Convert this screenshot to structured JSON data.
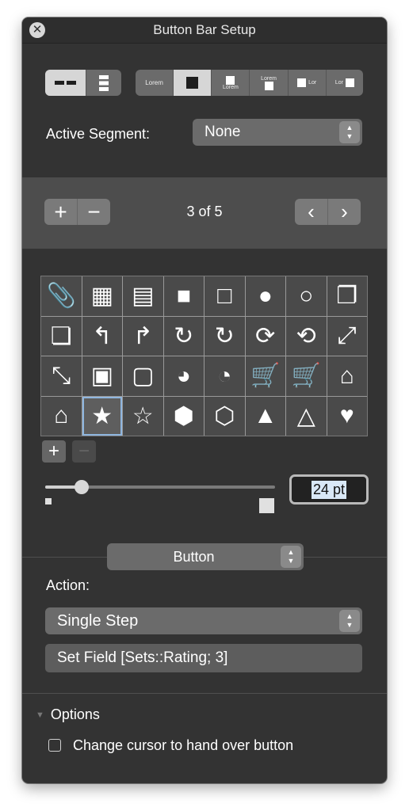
{
  "window": {
    "title": "Button Bar Setup"
  },
  "orientation": {
    "options": [
      {
        "name": "horizontal",
        "icon": "horizontal-layout-icon",
        "selected": true
      },
      {
        "name": "vertical",
        "icon": "vertical-layout-icon",
        "selected": false
      }
    ]
  },
  "style_segments": {
    "lorem_label": "Lorem",
    "lor_label": "Lor",
    "selected_index": 1
  },
  "active_segment": {
    "label": "Active Segment:",
    "value": "None"
  },
  "pager": {
    "text": "3 of 5",
    "add_symbol": "+",
    "remove_symbol": "−",
    "prev_symbol": "‹",
    "next_symbol": "›"
  },
  "icon_grid": {
    "icons": [
      "paperclip-icon",
      "table-filled-icon",
      "table-outline-icon",
      "box-filled-icon",
      "box-outline-icon",
      "speech-bubble-filled-icon",
      "speech-bubble-outline-icon",
      "copy-filled-icon",
      "copy-outline-icon",
      "back-arrow-filled-icon",
      "back-arrow-outline-icon",
      "refresh-filled-icon",
      "refresh-outline-icon",
      "sync-filled-icon",
      "sync-outline-icon",
      "expand-filled-icon",
      "expand-outline-icon",
      "id-card-filled-icon",
      "id-card-outline-icon",
      "pie-chart-filled-icon",
      "pie-chart-outline-icon",
      "cart-filled-icon",
      "cart-outline-icon",
      "home-filled-icon",
      "home-outline-icon",
      "star-filled-icon",
      "star-outline-icon",
      "octagon-alert-filled-icon",
      "octagon-alert-outline-icon",
      "warning-filled-icon",
      "warning-outline-icon",
      "heart-filled-icon"
    ],
    "glyphs": [
      "📎",
      "▦",
      "▤",
      "■",
      "□",
      "●",
      "○",
      "❐",
      "❏",
      "↰",
      "↱",
      "↻",
      "↻",
      "⟳",
      "⟲",
      "⤢",
      "⤡",
      "▣",
      "▢",
      "◕",
      "◔",
      "🛒",
      "🛒",
      "⌂",
      "⌂",
      "★",
      "☆",
      "⬢",
      "⬡",
      "▲",
      "△",
      "♥"
    ],
    "selected_index": 25,
    "add_symbol": "+",
    "remove_symbol": "−"
  },
  "size": {
    "value": "24 pt",
    "slider_fraction": 0.16
  },
  "type_popup": {
    "value": "Button"
  },
  "action": {
    "label": "Action:",
    "step": "Single Step",
    "detail": "Set Field [Sets::Rating; 3]"
  },
  "options": {
    "label": "Options",
    "checkbox_label": "Change cursor to hand over button",
    "checked": false
  }
}
